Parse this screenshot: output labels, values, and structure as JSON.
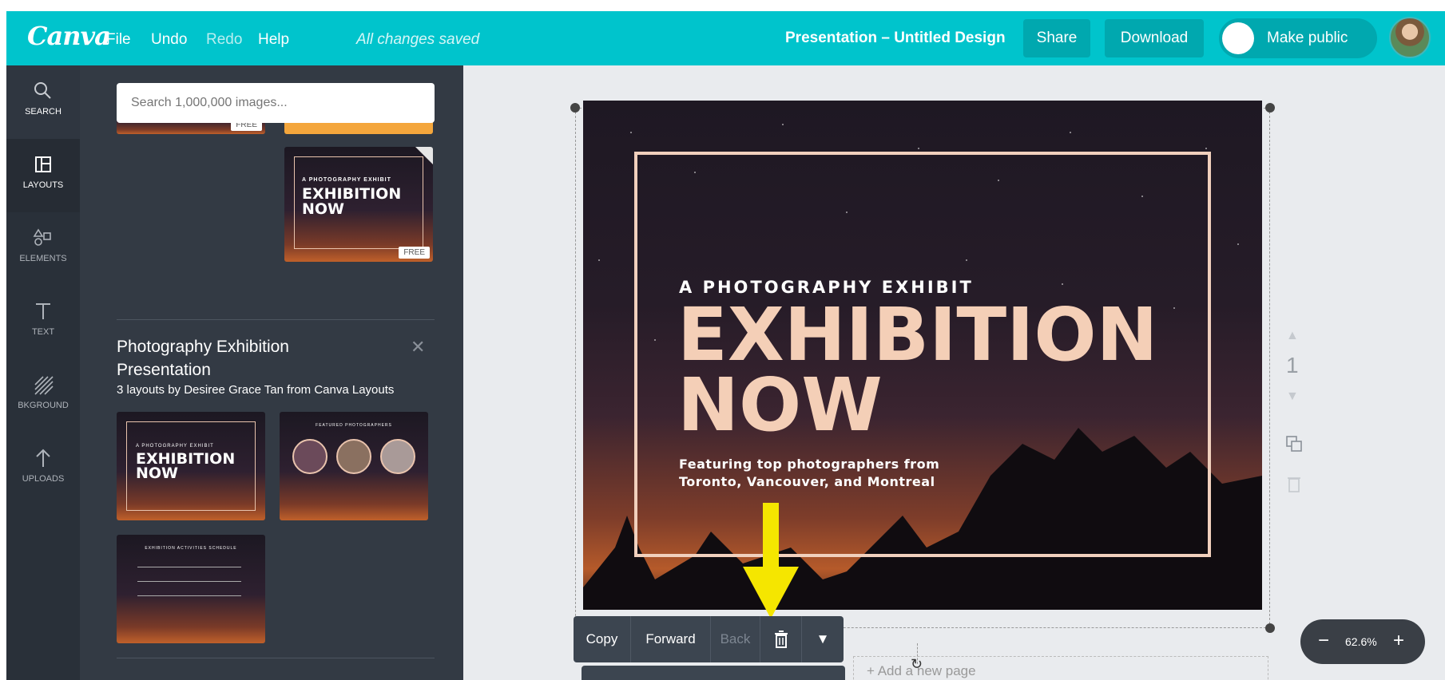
{
  "topbar": {
    "logo": "Canva",
    "menu": [
      "File",
      "Undo",
      "Redo",
      "Help"
    ],
    "saved_status": "All changes saved",
    "doc_title": "Presentation – Untitled Design",
    "share_label": "Share",
    "download_label": "Download",
    "make_public_label": "Make public"
  },
  "leftnav": [
    {
      "label": "SEARCH",
      "icon": "search-icon"
    },
    {
      "label": "LAYOUTS",
      "icon": "layouts-icon"
    },
    {
      "label": "ELEMENTS",
      "icon": "elements-icon"
    },
    {
      "label": "TEXT",
      "icon": "text-icon"
    },
    {
      "label": "BKGROUND",
      "icon": "background-icon"
    },
    {
      "label": "UPLOADS",
      "icon": "upload-icon"
    }
  ],
  "sidepanel": {
    "search_placeholder": "Search 1,000,000 images...",
    "free_badge": "FREE",
    "featured_thumb": {
      "kicker": "A PHOTOGRAPHY EXHIBIT",
      "title": "EXHIBITION NOW"
    },
    "info": {
      "title": "Photography Exhibition Presentation",
      "subtitle": "3 layouts by Desiree Grace Tan from Canva Layouts"
    },
    "layout_thumbs": {
      "thumb1_kicker": "A PHOTOGRAPHY EXHIBIT",
      "thumb1_title": "EXHIBITION NOW",
      "thumb2_title": "FEATURED PHOTOGRAPHERS",
      "thumb3_title": "EXHIBITION ACTIVITIES SCHEDULE"
    }
  },
  "slide": {
    "kicker": "A PHOTOGRAPHY EXHIBIT",
    "headline_1": "EXHIBITION",
    "headline_2": "NOW",
    "featuring": "Featuring top photographers from Toronto, Vancouver, and Montreal",
    "page_number": "1"
  },
  "element_toolbar": {
    "copy": "Copy",
    "forward": "Forward",
    "back": "Back"
  },
  "zoom": {
    "value": "62.6%",
    "minus": "−",
    "plus": "+"
  },
  "add_page_label": "+ Add a new page",
  "colors": {
    "brand_teal": "#00c4cc",
    "panel_dark": "#333a44",
    "nav_dark": "#293039",
    "accent_peach": "#f4cfb7",
    "arrow_yellow": "#f5e600"
  }
}
